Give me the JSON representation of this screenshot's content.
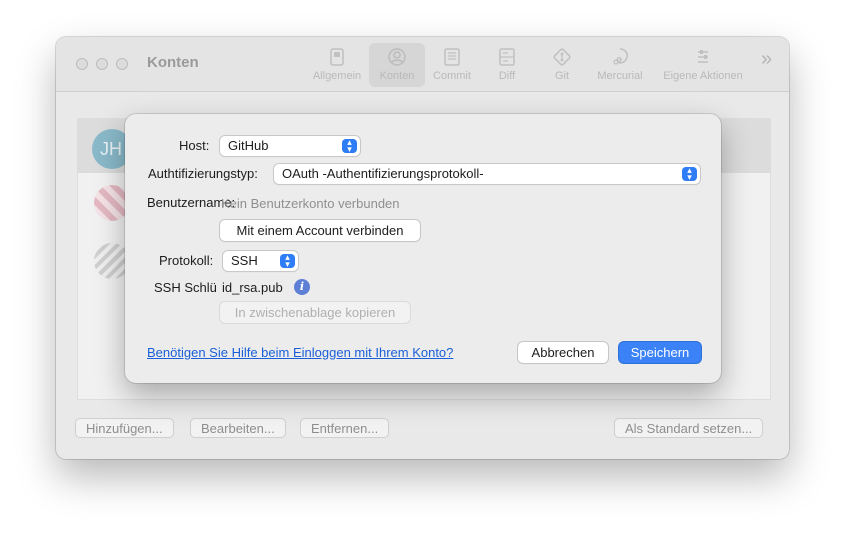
{
  "window": {
    "title": "Konten",
    "toolbar": [
      {
        "label": "Allgemein",
        "icon": "switch-icon"
      },
      {
        "label": "Konten",
        "icon": "account-icon",
        "active": true
      },
      {
        "label": "Commit",
        "icon": "commit-icon"
      },
      {
        "label": "Diff",
        "icon": "diff-icon"
      },
      {
        "label": "Git",
        "icon": "git-icon"
      },
      {
        "label": "Mercurial",
        "icon": "mercurial-icon"
      },
      {
        "label": "Eigene Aktionen",
        "icon": "custom-actions-icon"
      }
    ],
    "more": "»",
    "accounts": [
      {
        "initials": "JH"
      }
    ],
    "buttons": {
      "add": "Hinzufügen...",
      "edit": "Bearbeiten...",
      "remove": "Entfernen...",
      "set_default": "Als Standard setzen..."
    }
  },
  "dialog": {
    "host_label": "Host:",
    "host_value": "GitHub",
    "auth_label": "Authtifizierungstyp:",
    "auth_value": "OAuth -Authentifizierungsprotokoll-",
    "username_label": "Benutzername:",
    "username_value": "Kein Benutzerkonto verbunden",
    "connect_button": "Mit einem Account verbinden",
    "protocol_label": "Protokoll:",
    "protocol_value": "SSH",
    "ssh_key_label": "SSH Schlü",
    "ssh_key_value": "id_rsa.pub",
    "copy_button": "In zwischenablage kopieren",
    "help_link": "Benötigen Sie Hilfe beim Einloggen mit Ihrem Konto?",
    "cancel_button": "Abbrechen",
    "save_button": "Speichern"
  },
  "colors": {
    "accent": "#3b82f7",
    "link": "#1a5fd8"
  }
}
